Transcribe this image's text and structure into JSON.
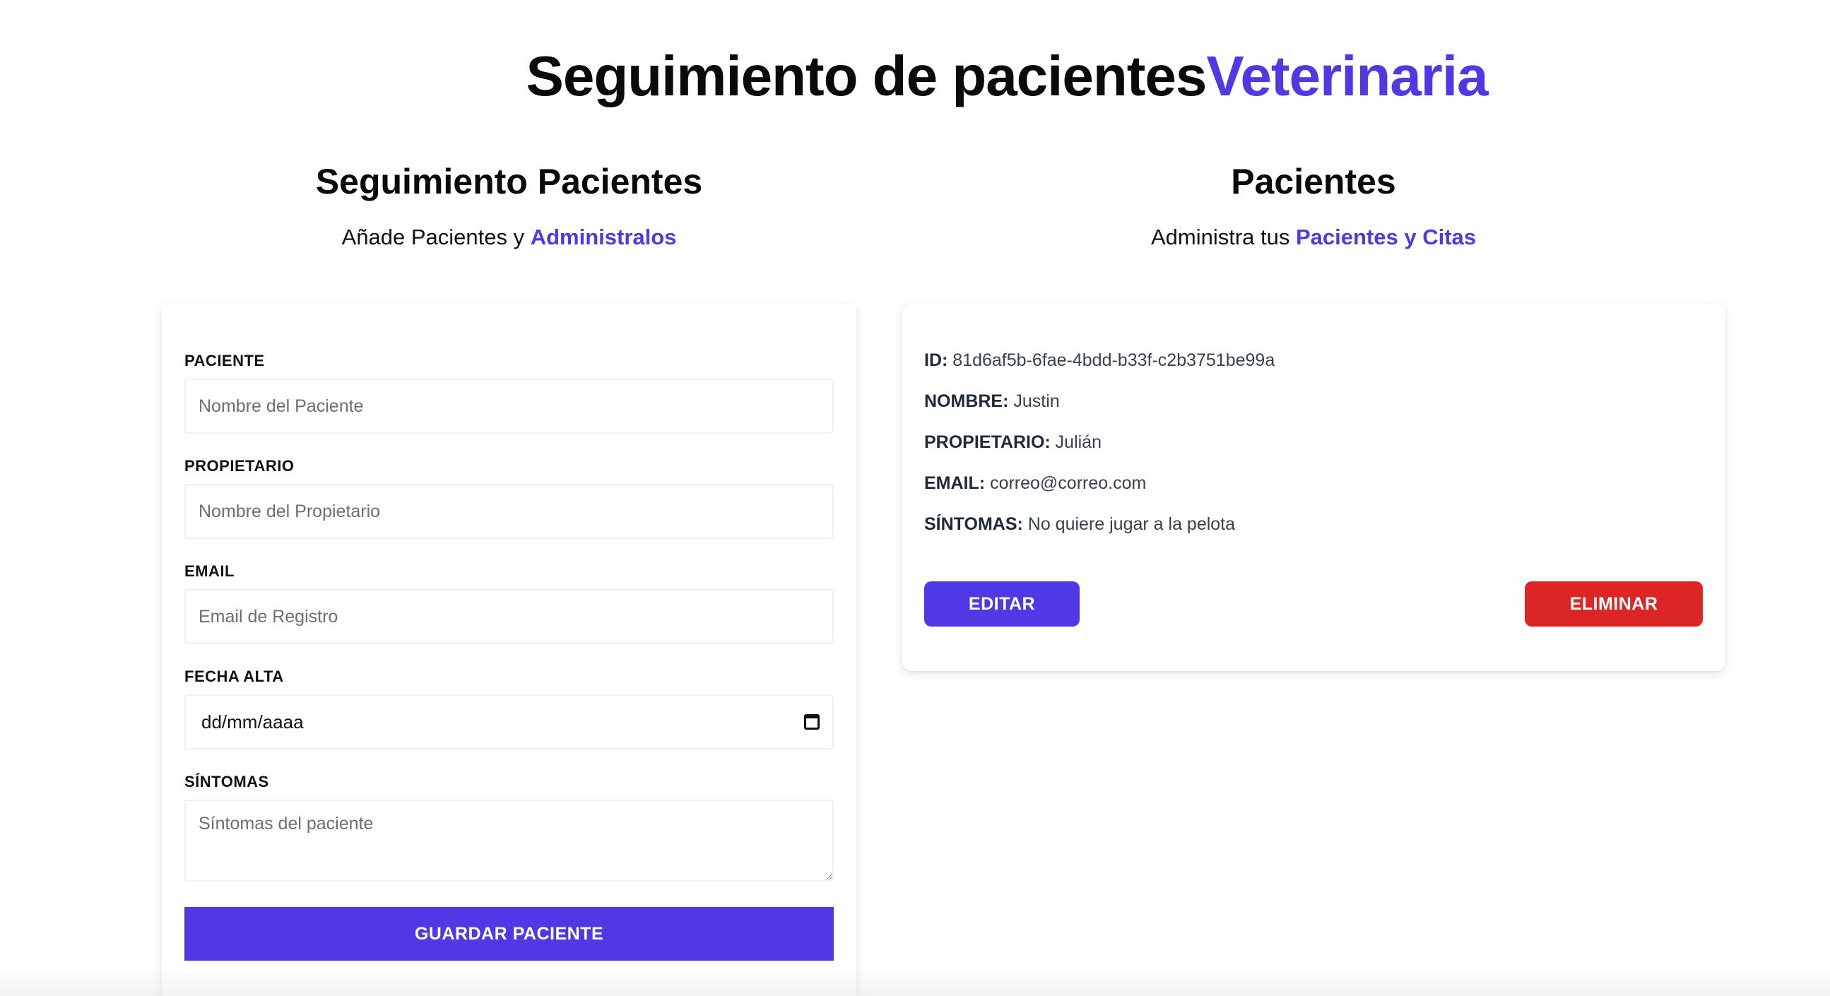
{
  "header": {
    "title_main": "Seguimiento de pacientes",
    "title_accent": "Veterinaria"
  },
  "form_section": {
    "title": "Seguimiento Pacientes",
    "subtitle_prefix": "Añade Pacientes y ",
    "subtitle_accent": "Administralos"
  },
  "list_section": {
    "title": "Pacientes",
    "subtitle_prefix": "Administra tus ",
    "subtitle_accent": "Pacientes y Citas"
  },
  "form": {
    "paciente": {
      "label": "PACIENTE",
      "placeholder": "Nombre del Paciente",
      "value": ""
    },
    "propietario": {
      "label": "PROPIETARIO",
      "placeholder": "Nombre del Propietario",
      "value": ""
    },
    "email": {
      "label": "EMAIL",
      "placeholder": "Email de Registro",
      "value": ""
    },
    "fecha_alta": {
      "label": "FECHA ALTA",
      "value": "dd/mm/aaaa"
    },
    "sintomas": {
      "label": "SÍNTOMAS",
      "placeholder": "Síntomas del paciente",
      "value": ""
    },
    "submit_label": "GUARDAR PACIENTE"
  },
  "patient": {
    "id_label": "ID:",
    "id_value": "81d6af5b-6fae-4bdd-b33f-c2b3751be99a",
    "nombre_label": "NOMBRE:",
    "nombre_value": "Justin",
    "propietario_label": "PROPIETARIO:",
    "propietario_value": "Julián",
    "email_label": "EMAIL:",
    "email_value": "correo@correo.com",
    "sintomas_label": "SÍNTOMAS:",
    "sintomas_value": "No quiere jugar a la pelota",
    "edit_label": "EDITAR",
    "delete_label": "ELIMINAR"
  },
  "colors": {
    "accent": "#4f39e6",
    "danger": "#dc2626"
  },
  "icons": {
    "date_picker": "calendar-icon"
  }
}
